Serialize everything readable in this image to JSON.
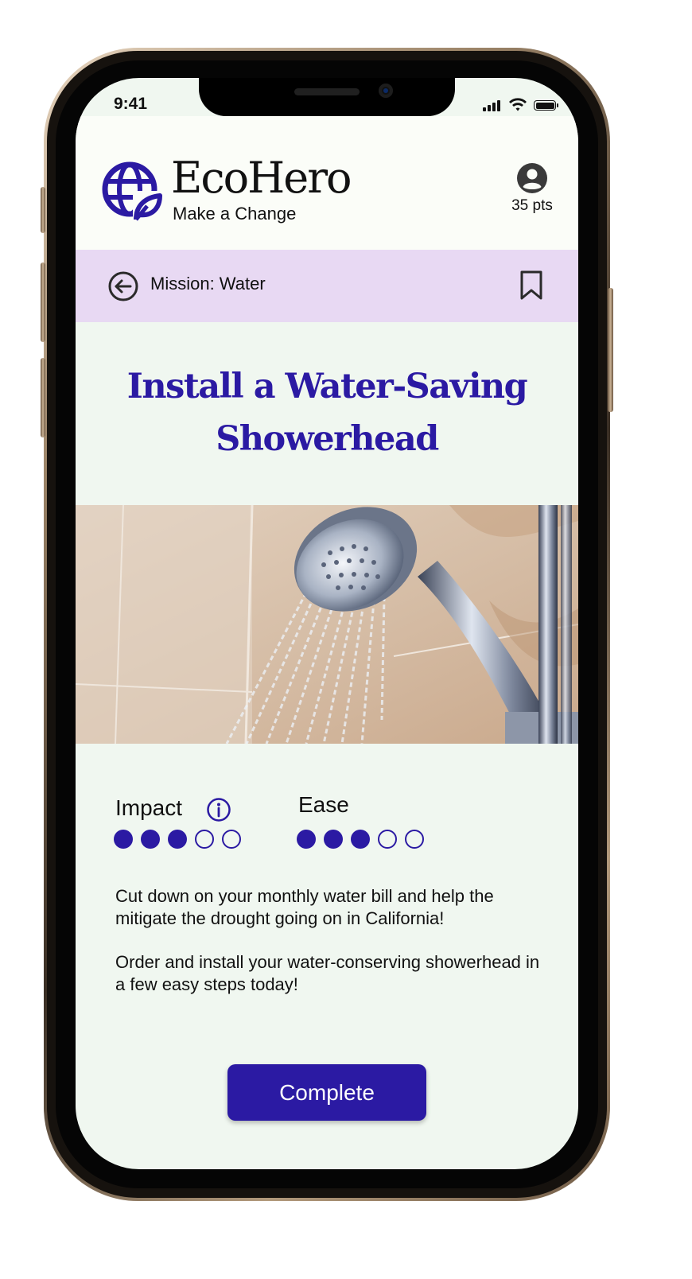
{
  "status_bar": {
    "time": "9:41"
  },
  "header": {
    "brand": "EcoHero",
    "tagline": "Make a Change",
    "points": "35 pts"
  },
  "mission_bar": {
    "label": "Mission: Water"
  },
  "title": "Install a Water-Saving Showerhead",
  "ratings": {
    "impact": {
      "label": "Impact",
      "level": 3,
      "max": 5
    },
    "ease": {
      "label": "Ease",
      "level": 3,
      "max": 5
    }
  },
  "description": [
    "Cut down on your monthly water bill and help the mitigate the drought going on in California!",
    "Order and install your water-conserving showerhead in a few easy steps today!"
  ],
  "actions": {
    "complete_label": "Complete"
  },
  "icons": {
    "logo": "globe-leaf-icon",
    "profile": "user-circle-icon",
    "back": "arrow-left-circle-icon",
    "bookmark": "bookmark-icon",
    "info": "info-icon"
  },
  "colors": {
    "accent": "#2b1aa3",
    "mission_bar_bg": "#e8d9f3",
    "screen_bg": "#f0f7f0",
    "header_bg": "#fbfdf8"
  }
}
